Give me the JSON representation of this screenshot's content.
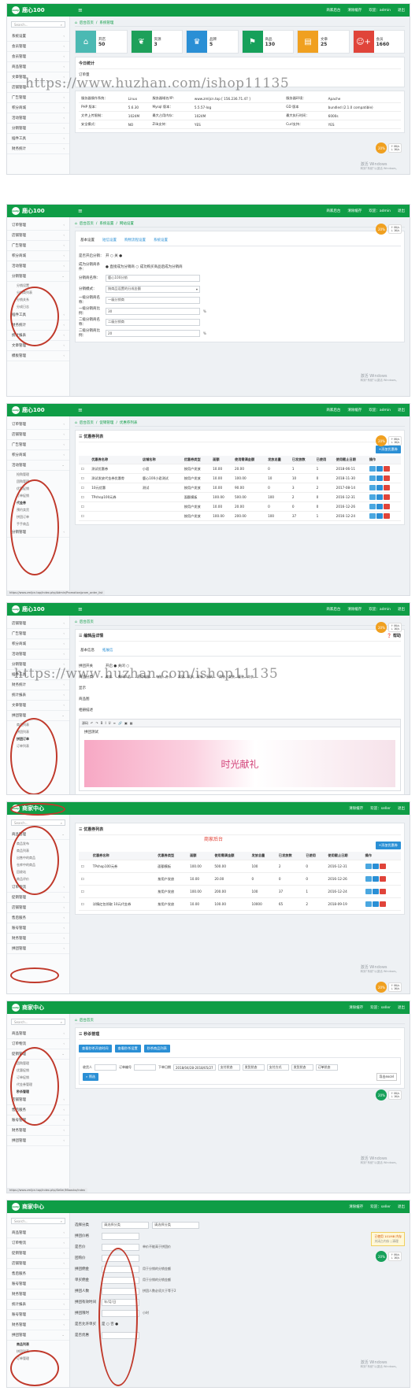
{
  "watermark": "https://www.huzhan.com/ishop11135",
  "win_activate": {
    "title": "激活 Windows",
    "sub": "转到“系统”以激活 Windows。"
  },
  "admin_top": {
    "logo": "鹿心100",
    "badge": "zmlijr",
    "links": [
      "商家后台",
      "清除缓存",
      "欢迎：admin",
      "退出"
    ]
  },
  "seller_top": {
    "logo": "商家中心",
    "badge": "zmlijr",
    "links": [
      "清除缓存",
      "欢迎：seller",
      "退出"
    ]
  },
  "search_placeholder": "Search...",
  "home_crumb": "首页",
  "s1": {
    "crumb": [
      "后台首页",
      "系统管理"
    ],
    "sidebar": [
      "系统设置",
      "会员管理",
      "会员管理",
      "商品管理",
      "文章管理",
      "店铺管理",
      "广告管理",
      "积分商城",
      "活动管理",
      "分销管理",
      "插件工具",
      "财务统计"
    ],
    "stats": [
      {
        "label": "开店",
        "value": "50",
        "color": "#4bb9b3",
        "icon": "home-icon"
      },
      {
        "label": "资源",
        "value": "3",
        "color": "#1ea05a",
        "icon": "leaf-icon"
      },
      {
        "label": "品牌",
        "value": "5",
        "color": "#2a8fd5",
        "icon": "trophy-icon"
      },
      {
        "label": "商品",
        "value": "130",
        "color": "#16a05a",
        "icon": "flag-icon"
      },
      {
        "label": "文章",
        "value": "25",
        "color": "#f0a020",
        "icon": "file-icon"
      },
      {
        "label": "会员",
        "value": "1660",
        "color": "#e0443a",
        "icon": "user-plus-icon"
      }
    ],
    "today_title": "今日统计",
    "today_row": "订单量",
    "info_rows": [
      [
        "服务器操作系统：",
        "Linux",
        "服务器域名/IP:",
        "www.zmljcn.top [ 156.236.71.47 ]",
        "服务器环境：",
        "Apache"
      ],
      [
        "PHP 版本：",
        "5.6.30",
        "Mysql 版本：",
        "5.5.57-log",
        "GD 版本",
        "bundled (2.1.0 compatible)"
      ],
      [
        "文件上传限制：",
        "1024M",
        "最大占用内存：",
        "1024M",
        "最大执行时间：",
        "6000s"
      ],
      [
        "安全模式：",
        "NO",
        "Zlib支持：",
        "YES",
        "Curl支持：",
        "YES"
      ]
    ]
  },
  "bubble": {
    "pct": "20%",
    "up": "↑ 0K/s",
    "down": "↓ 1K/s"
  },
  "s2": {
    "crumb": [
      "后台首页",
      "系统设置",
      "网站设置"
    ],
    "sidebar": [
      "订单管理",
      "店铺管理",
      "广告管理",
      "积分商城",
      "活动管理",
      "分销管理",
      "分销设置",
      "分销商列表",
      "分销关系",
      "分成日志",
      "插件工具",
      "财务统计",
      "统计报表",
      "文章管理",
      "模板管理"
    ],
    "tabs": [
      "基本设置",
      "短信设置",
      "购物流程设置",
      "系统设置"
    ],
    "fields": [
      {
        "label": "是否开启分销：",
        "value": "开 ○ 关 ●",
        "note": ""
      },
      {
        "label": "成为分销商条件：",
        "value": "● 直接成为分销商 ○ 成功购买商品后成为分销商",
        "note": ""
      },
      {
        "label": "分销商名称：",
        "value": "鹿心100分销",
        "note": ""
      },
      {
        "label": "分销模式：",
        "value": "按商品设置的分成金额",
        "note": ""
      },
      {
        "label": "一级分销商名称：",
        "value": "一级分销商",
        "note": ""
      },
      {
        "label": "一级分销商比例：",
        "value": "30",
        "note": "%"
      },
      {
        "label": "二级分销商名称：",
        "value": "二级分销商",
        "note": ""
      },
      {
        "label": "二级分销商比例：",
        "value": "20",
        "note": "%"
      }
    ]
  },
  "s3": {
    "crumb": [
      "后台首页",
      "促销管理",
      "优惠券列表"
    ],
    "sidebar": [
      "订单管理",
      "店铺管理",
      "广告管理",
      "积分商城",
      "活动管理",
      "抢购管理",
      "团购管理",
      "优惠促销",
      "订单促销",
      "代金券",
      "预约卖货",
      "拼团订单",
      "手手商品",
      "分销管理"
    ],
    "panel_title": "优惠券列表",
    "add_btn": "+添加优惠券",
    "headers": [
      "优惠券名称",
      "店铺名称",
      "优惠券类型",
      "面额",
      "使用需满金额",
      "发放总量",
      "已发放数",
      "已使用",
      "使用截止日期",
      "操作"
    ],
    "rows": [
      [
        "测试优惠券",
        "小君",
        "按用户发放",
        "10.00",
        "20.00",
        "0",
        "1",
        "1",
        "2018-06-11"
      ],
      [
        "测试发放代金券优惠劵",
        "鹿心100小君测试",
        "按用户发放",
        "10.00",
        "100.00",
        "10",
        "10",
        "0",
        "2018-11-30"
      ],
      [
        "10元优惠",
        "测试",
        "按用户发放",
        "10.00",
        "90.00",
        "0",
        "3",
        "2",
        "2017-08-14"
      ],
      [
        "TPshop100元券",
        "",
        "面额模板",
        "100.00",
        "500.00",
        "100",
        "2",
        "0",
        "2016-12-31"
      ],
      [
        "",
        "",
        "按用户发放",
        "10.00",
        "20.00",
        "0",
        "0",
        "0",
        "2016-12-26"
      ],
      [
        "",
        "",
        "按用户发放",
        "100.00",
        "200.00",
        "100",
        "37",
        "1",
        "2016-12-24"
      ]
    ],
    "status": "https://www.zmljcn.top/index.php/Admin/Promotion/prom_order_list"
  },
  "s4": {
    "crumb": [
      "后台首页"
    ],
    "sidebar": [
      "店铺管理",
      "广告管理",
      "积分商城",
      "活动管理",
      "分销管理",
      "插件工具",
      "财务统计",
      "统计报表",
      "文章管理",
      "拼团管理",
      "商品列表",
      "拼团列表",
      "拼团订单",
      "订单列表"
    ],
    "panel_title": "编辑品详情",
    "tabs": [
      "基本信息",
      "拓展信"
    ],
    "help": "帮助",
    "rows": [
      "拼团开关",
      "商品分类",
      "显示",
      "商品图",
      "相册描述"
    ],
    "toggle": "开启 ● 关闭 ○",
    "categories": [
      "美妆",
      "数码产品",
      "家用电器",
      "电脑、办公",
      "家居、家具、家装、厨具",
      "男装、女装、童装、内衣"
    ],
    "source_btn": "源码",
    "editor_caption": "拼团测试",
    "editor_image": "时光献礼"
  },
  "s5": {
    "sidebar": [
      "商品管理",
      "商品发布",
      "商品列表",
      "出售中的商品",
      "仓库中的商品",
      "回收站",
      "商品评价",
      "订单物流",
      "促销管理",
      "店铺管理",
      "售后服务",
      "账号管理",
      "财务管理",
      "拼团管理"
    ],
    "red_note": "商家后台",
    "panel_title": "优惠券列表",
    "add_btn": "+添加优惠券",
    "headers": [
      "优惠券名称",
      "优惠券类型",
      "面额",
      "使用需满金额",
      "发放总量",
      "已发放数",
      "已使用",
      "使用截止日期",
      "操作"
    ],
    "rows": [
      [
        "TPshop100元券",
        "面额模板",
        "100.00",
        "500.00",
        "100",
        "2",
        "0",
        "2016-12-31"
      ],
      [
        "",
        "按用户发放",
        "10.00",
        "20.00",
        "0",
        "0",
        "0",
        "2016-12-26"
      ],
      [
        "",
        "按用户发放",
        "100.00",
        "200.00",
        "100",
        "37",
        "1",
        "2016-12-24"
      ],
      [
        "详情红包领取 10元代金券",
        "按用户发放",
        "10.00",
        "100.00",
        "10000",
        "65",
        "2",
        "2018-09-19"
      ]
    ]
  },
  "s6": {
    "crumb": [
      "后台首页"
    ],
    "sidebar": [
      "商品管理",
      "订单物流",
      "促销管理",
      "团购管理",
      "优惠促销",
      "订单促销",
      "代金券管理",
      "秒杀管理",
      "店铺管理",
      "售后服务",
      "账号管理",
      "财务管理",
      "拼团管理"
    ],
    "panel_title": "秒杀管理",
    "btns": [
      "查看秒杀开放时间",
      "查看秒杀设置",
      "秒杀商品列表"
    ],
    "filters": [
      "收货人",
      "订单编号",
      "下单日期",
      "2018/04/28-2018/05/27",
      "支付状态",
      "发货状态",
      "支付方式",
      "发货状态",
      "订单状态"
    ],
    "search_btn": "筛选",
    "export_btn": "导出excel",
    "status": "https://www.zmljcn.top/index.php/Seller/Miaosha/index"
  },
  "s7": {
    "sidebar": [
      "商品管理",
      "订单物流",
      "促销管理",
      "店铺管理",
      "售后服务",
      "账号管理",
      "财务管理",
      "统计报表",
      "账号管理",
      "财务管理",
      "拼团管理",
      "商品列表",
      "拼团列表",
      "订单管理"
    ],
    "fields": [
      {
        "label": "选择分类",
        "value": "请选择分类",
        "note": "请选择分类"
      },
      {
        "label": "拼团价格",
        "value": "",
        "note": ""
      },
      {
        "label": "是否价",
        "value": "",
        "note": "单价不能高于拼团价"
      },
      {
        "label": "团购价",
        "value": "",
        "note": ""
      },
      {
        "label": "拼团佣金",
        "value": "",
        "note": "用于分销的分销金额"
      },
      {
        "label": "单买佣金",
        "value": "",
        "note": "用于分销的分销金额"
      },
      {
        "label": "拼团人数",
        "value": "",
        "note": "拼团人数必须大于等于2"
      },
      {
        "label": "拼团有效时间",
        "value": "年/月/日",
        "note": ""
      },
      {
        "label": "拼团限时",
        "value": "",
        "note": "小时"
      },
      {
        "label": "是否允许单买",
        "value": "是 ○ 否 ●",
        "note": ""
      },
      {
        "label": "是否优惠",
        "value": "",
        "note": ""
      }
    ],
    "alert_title": "已使用 101MB 内存",
    "alert_sub": "关闭占内存 | 清理"
  }
}
